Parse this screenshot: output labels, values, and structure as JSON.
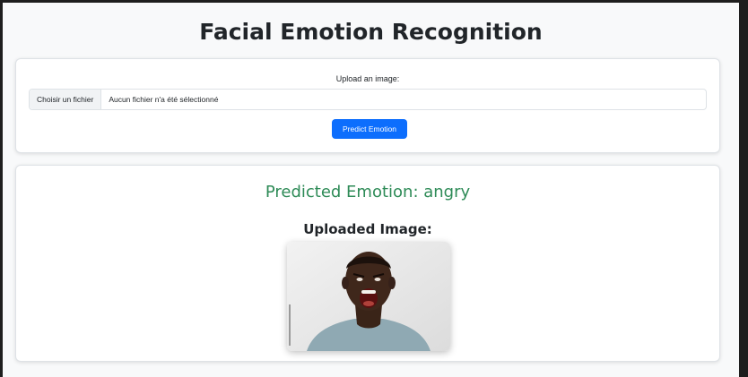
{
  "page": {
    "title": "Facial Emotion Recognition"
  },
  "upload": {
    "label": "Upload an image:",
    "file_button": "Choisir un fichier",
    "file_status": "Aucun fichier n'a été sélectionné",
    "predict_label": "Predict Emotion"
  },
  "result": {
    "predicted_text": "Predicted Emotion: angry",
    "uploaded_label": "Uploaded Image:"
  },
  "colors": {
    "accent": "#0d6efd",
    "result_text": "#2e8b57",
    "background": "#f8f9fa"
  }
}
